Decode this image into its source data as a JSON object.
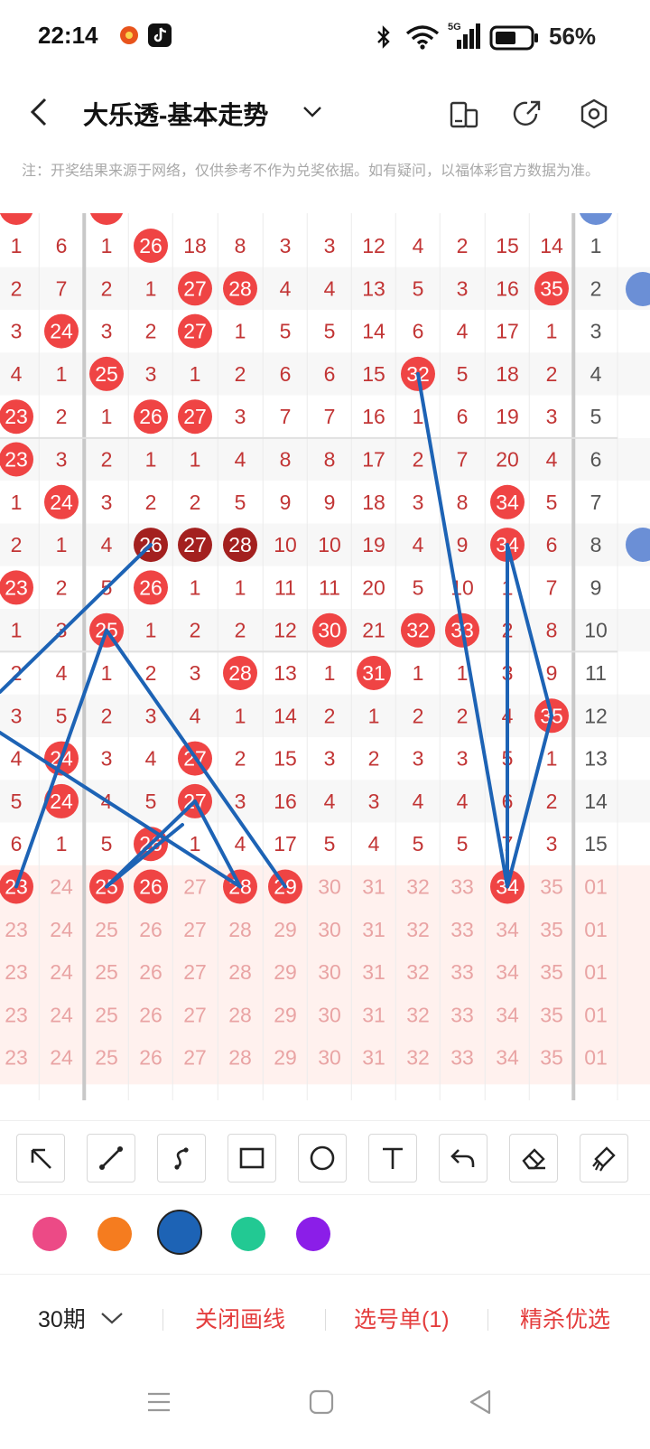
{
  "status": {
    "time": "22:14",
    "battery": "56%",
    "network": "5G"
  },
  "titlebar": {
    "title": "大乐透-基本走势"
  },
  "notice": "注：开奖结果来源于网络，仅供参考不作为兑奖依据。如有疑问，以福体彩官方数据为准。",
  "colors": {
    "red_ball": "#ef4444",
    "dark_ball": "#a3201f",
    "line": "#1d63b5",
    "grid_red": "#c23535",
    "blue_ball": "#6b8fd6"
  },
  "chart": {
    "rows": [
      [
        "1",
        "6",
        "1",
        "26",
        "18",
        "8",
        "3",
        "3",
        "12",
        "4",
        "2",
        "15",
        "14",
        "1"
      ],
      [
        "2",
        "7",
        "2",
        "1",
        "27",
        "28",
        "4",
        "4",
        "13",
        "5",
        "3",
        "16",
        "35",
        "2"
      ],
      [
        "3",
        "24",
        "3",
        "2",
        "27",
        "1",
        "5",
        "5",
        "14",
        "6",
        "4",
        "17",
        "1",
        "3"
      ],
      [
        "4",
        "1",
        "25",
        "3",
        "1",
        "2",
        "6",
        "6",
        "15",
        "32",
        "5",
        "18",
        "2",
        "4"
      ],
      [
        "23",
        "2",
        "1",
        "26",
        "27",
        "3",
        "7",
        "7",
        "16",
        "1",
        "6",
        "19",
        "3",
        "5"
      ],
      [
        "23",
        "3",
        "2",
        "1",
        "1",
        "4",
        "8",
        "8",
        "17",
        "2",
        "7",
        "20",
        "4",
        "6"
      ],
      [
        "1",
        "24",
        "3",
        "2",
        "2",
        "5",
        "9",
        "9",
        "18",
        "3",
        "8",
        "34",
        "5",
        "7"
      ],
      [
        "2",
        "1",
        "4",
        "26",
        "27",
        "28",
        "10",
        "10",
        "19",
        "4",
        "9",
        "34",
        "6",
        "8"
      ],
      [
        "23",
        "2",
        "5",
        "26",
        "1",
        "1",
        "11",
        "11",
        "20",
        "5",
        "10",
        "1",
        "7",
        "9"
      ],
      [
        "1",
        "3",
        "25",
        "1",
        "2",
        "2",
        "12",
        "30",
        "21",
        "32",
        "33",
        "2",
        "8",
        "10"
      ],
      [
        "2",
        "4",
        "1",
        "2",
        "3",
        "28",
        "13",
        "1",
        "31",
        "1",
        "1",
        "3",
        "9",
        "11"
      ],
      [
        "3",
        "5",
        "2",
        "3",
        "4",
        "1",
        "14",
        "2",
        "1",
        "2",
        "2",
        "4",
        "35",
        "12"
      ],
      [
        "4",
        "24",
        "3",
        "4",
        "27",
        "2",
        "15",
        "3",
        "2",
        "3",
        "3",
        "5",
        "1",
        "13"
      ],
      [
        "5",
        "24",
        "4",
        "5",
        "27",
        "3",
        "16",
        "4",
        "3",
        "4",
        "4",
        "6",
        "2",
        "14"
      ],
      [
        "6",
        "1",
        "5",
        "26",
        "1",
        "4",
        "17",
        "5",
        "4",
        "5",
        "5",
        "7",
        "3",
        "15"
      ]
    ],
    "selection_row": [
      "23",
      "24",
      "25",
      "26",
      "27",
      "28",
      "29",
      "30",
      "31",
      "32",
      "33",
      "34",
      "35",
      "01"
    ],
    "selected_numbers": [
      "23",
      "25",
      "26",
      "28",
      "29",
      "34"
    ],
    "blank_rows": [
      [
        "23",
        "24",
        "25",
        "26",
        "27",
        "28",
        "29",
        "30",
        "31",
        "32",
        "33",
        "34",
        "35",
        "01"
      ],
      [
        "23",
        "24",
        "25",
        "26",
        "27",
        "28",
        "29",
        "30",
        "31",
        "32",
        "33",
        "34",
        "35",
        "01"
      ],
      [
        "23",
        "24",
        "25",
        "26",
        "27",
        "28",
        "29",
        "30",
        "31",
        "32",
        "33",
        "34",
        "35",
        "01"
      ],
      [
        "23",
        "24",
        "25",
        "26",
        "27",
        "28",
        "29",
        "30",
        "31",
        "32",
        "33",
        "34",
        "35",
        "01"
      ]
    ]
  },
  "tools": [
    {
      "name": "arrow-tool",
      "icon": "arrow-icon"
    },
    {
      "name": "line-tool",
      "icon": "line-icon"
    },
    {
      "name": "curve-tool",
      "icon": "curve-icon"
    },
    {
      "name": "rect-tool",
      "icon": "rectangle-icon"
    },
    {
      "name": "circle-tool",
      "icon": "circle-icon"
    },
    {
      "name": "text-tool",
      "icon": "text-icon"
    },
    {
      "name": "undo-tool",
      "icon": "undo-icon"
    },
    {
      "name": "eraser-tool",
      "icon": "eraser-icon"
    },
    {
      "name": "clear-tool",
      "icon": "brush-clear-icon"
    }
  ],
  "palette": [
    "#ec4a86",
    "#f57c1f",
    "#1d63b5",
    "#22c993",
    "#8b1ee8"
  ],
  "actions": {
    "period": "30期",
    "close_lines": "关闭画线",
    "pick_list": "选号单(1)",
    "premium": "精杀优选"
  }
}
